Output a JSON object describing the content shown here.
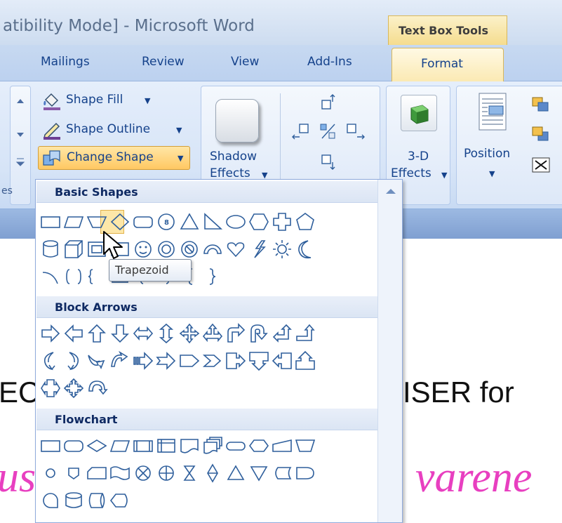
{
  "window": {
    "title": "atibility Mode] - Microsoft Word",
    "context_header": "Text Box Tools"
  },
  "tabs": [
    {
      "label": "Mailings"
    },
    {
      "label": "Review"
    },
    {
      "label": "View"
    },
    {
      "label": "Add-Ins"
    },
    {
      "label": "Format",
      "active": true
    }
  ],
  "ribbon": {
    "shape_fill": "Shape Fill",
    "shape_outline": "Shape Outline",
    "change_shape": "Change Shape",
    "shadow_effects": {
      "line1": "Shadow",
      "line2": "Effects"
    },
    "three_d_effects": {
      "line1": "3-D",
      "line2": "Effects"
    },
    "position": "Position",
    "group_fragment": "es"
  },
  "gallery": {
    "sections": [
      {
        "title": "Basic Shapes"
      },
      {
        "title": "Block Arrows"
      },
      {
        "title": "Flowchart"
      }
    ],
    "selected_shape": "Trapezoid",
    "tooltip": "Trapezoid"
  },
  "document": {
    "line_left": "EC",
    "line_right": "ISER for",
    "script_left": "us",
    "script_right": "varene"
  },
  "colors": {
    "ribbon_blue": "#dbe7f7",
    "accent_gold": "#ffc862",
    "doc_script_pink": "#e83fc0"
  }
}
